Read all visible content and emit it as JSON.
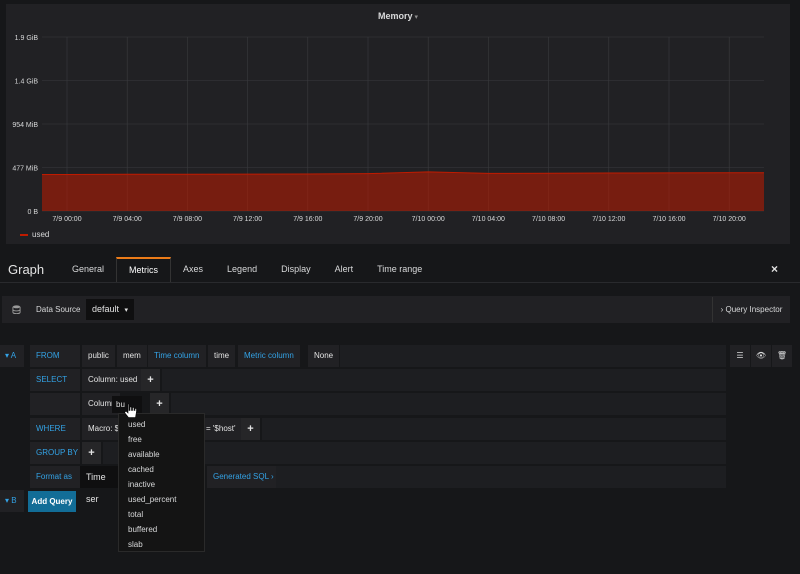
{
  "panel": {
    "title": "Memory",
    "yticks": [
      "1.9 GiB",
      "1.4 GiB",
      "954 MiB",
      "477 MiB",
      "0 B"
    ],
    "xticks": [
      "7/9 00:00",
      "7/9 04:00",
      "7/9 08:00",
      "7/9 12:00",
      "7/9 16:00",
      "7/9 20:00",
      "7/10 00:00",
      "7/10 04:00",
      "7/10 08:00",
      "7/10 12:00",
      "7/10 16:00",
      "7/10 20:00"
    ],
    "legend": "used",
    "series_color": "#bf1b00"
  },
  "chart_data": {
    "type": "area",
    "title": "Memory",
    "ylim": [
      0,
      2048
    ],
    "yunit_ticks": [
      "0 B",
      "477 MiB",
      "954 MiB",
      "1.4 GiB",
      "1.9 GiB"
    ],
    "x": [
      "7/9 00:00",
      "7/9 04:00",
      "7/9 08:00",
      "7/9 12:00",
      "7/9 16:00",
      "7/9 20:00",
      "7/10 00:00",
      "7/10 04:00",
      "7/10 08:00",
      "7/10 12:00",
      "7/10 16:00",
      "7/10 20:00"
    ],
    "series": [
      {
        "name": "used",
        "values": [
          430,
          432,
          433,
          434,
          436,
          440,
          460,
          443,
          445,
          447,
          448,
          450
        ]
      }
    ],
    "grid": true,
    "legend": "bottom-left"
  },
  "editor": {
    "title": "Graph",
    "tabs": [
      "General",
      "Metrics",
      "Axes",
      "Legend",
      "Display",
      "Alert",
      "Time range"
    ],
    "active_tab": "Metrics",
    "close_icon": "×"
  },
  "datasource": {
    "label": "Data Source",
    "value": "default",
    "inspector": "Query Inspector"
  },
  "query_a": {
    "letter": "A",
    "from_kw": "FROM",
    "from_schema": "public",
    "from_table": "mem",
    "time_col_label": "Time column",
    "time_col_value": "time",
    "metric_col_label": "Metric column",
    "metric_col_value": "None",
    "select_kw": "SELECT",
    "select_col1": "Column: used",
    "select_col2_prefix": "Column:",
    "select_col2_input": "bu",
    "where_kw": "WHERE",
    "where_macro": "Macro: $",
    "where_cond": "= '$host'",
    "groupby_kw": "GROUP BY",
    "format_kw": "Format as",
    "format_value": "Time ser",
    "generated_sql": "Generated SQL"
  },
  "query_b": {
    "letter": "B",
    "add_query": "Add Query"
  },
  "dropdown": [
    "used",
    "free",
    "available",
    "cached",
    "inactive",
    "used_percent",
    "total",
    "buffered",
    "slab"
  ]
}
